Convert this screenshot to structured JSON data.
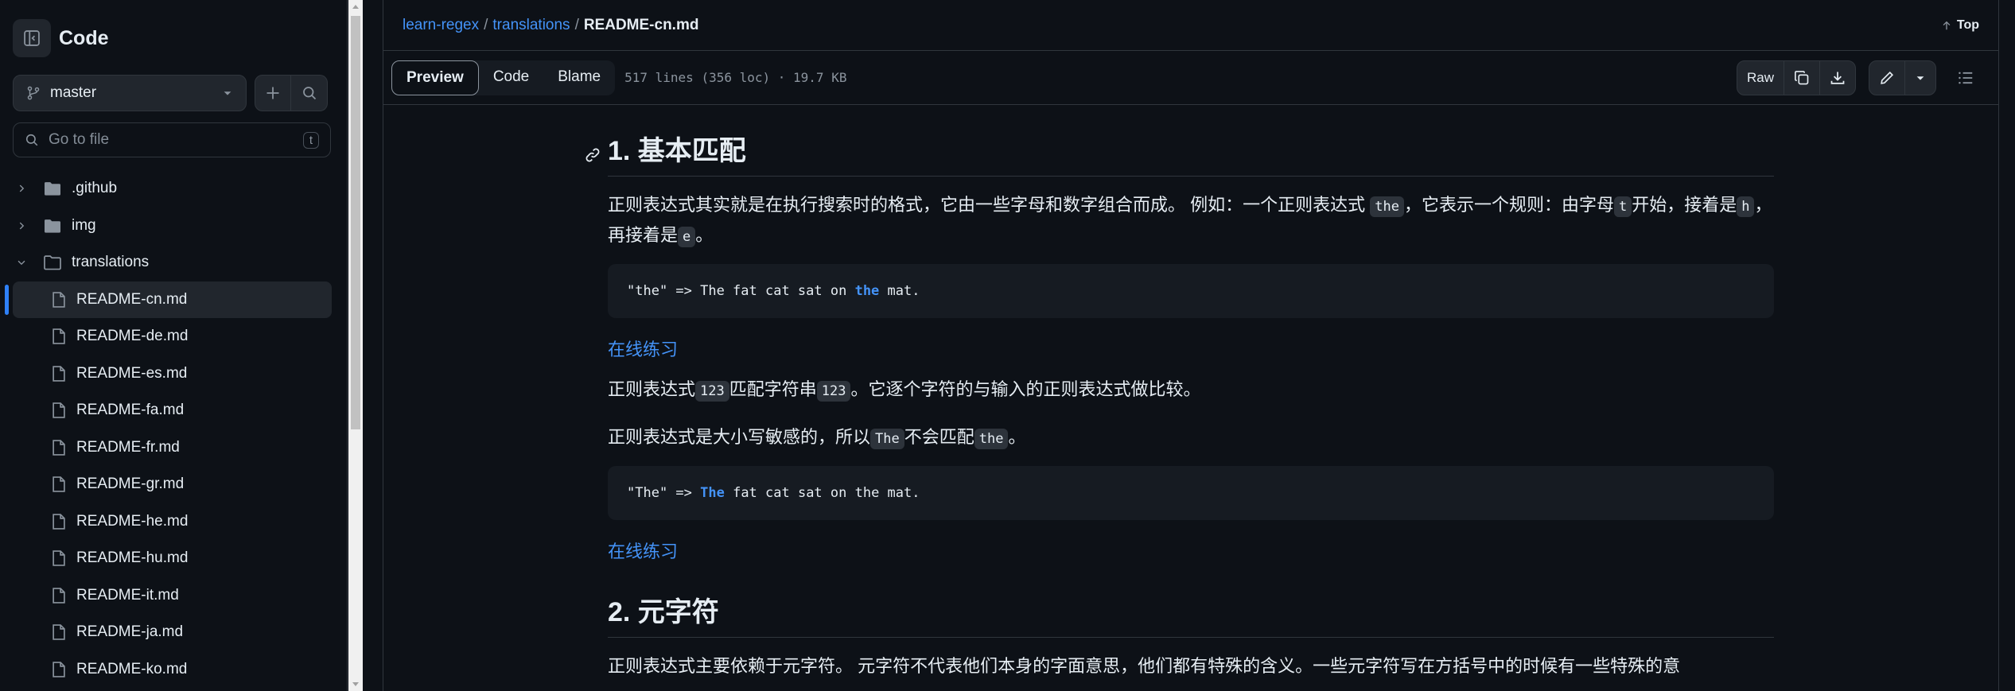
{
  "sidebar": {
    "title": "Code",
    "branch": "master",
    "search_placeholder": "Go to file",
    "search_kbd": "t",
    "tree": [
      {
        "label": ".github",
        "type": "folder",
        "expanded": false
      },
      {
        "label": "img",
        "type": "folder",
        "expanded": false
      },
      {
        "label": "translations",
        "type": "folder",
        "expanded": true
      },
      {
        "label": "README-cn.md",
        "type": "file",
        "selected": true
      },
      {
        "label": "README-de.md",
        "type": "file"
      },
      {
        "label": "README-es.md",
        "type": "file"
      },
      {
        "label": "README-fa.md",
        "type": "file"
      },
      {
        "label": "README-fr.md",
        "type": "file"
      },
      {
        "label": "README-gr.md",
        "type": "file"
      },
      {
        "label": "README-he.md",
        "type": "file"
      },
      {
        "label": "README-hu.md",
        "type": "file"
      },
      {
        "label": "README-it.md",
        "type": "file"
      },
      {
        "label": "README-ja.md",
        "type": "file"
      },
      {
        "label": "README-ko.md",
        "type": "file"
      }
    ]
  },
  "breadcrumb": {
    "repo": "learn-regex",
    "sep1": "/",
    "folder": "translations",
    "sep2": "/",
    "file": "README-cn.md"
  },
  "top_link": "Top",
  "toolbar": {
    "tabs": [
      "Preview",
      "Code",
      "Blame"
    ],
    "active_tab": "Preview",
    "meta": "517 lines (356 loc) · 19.7 KB",
    "raw": "Raw"
  },
  "article": {
    "h1": "1. 基本匹配",
    "p1_a": "正则表达式其实就是在执行搜索时的格式，它由一些字母和数字组合而成。 例如：一个正则表达式 ",
    "p1_code1": "the",
    "p1_b": "，它表示一个规则：由字母",
    "p1_code2": "t",
    "p1_c": "开始，接着是",
    "p1_code3": "h",
    "p1_d": "，再接着是",
    "p1_code4": "e",
    "p1_e": "。",
    "pre1_a": "\"the\" => The fat cat sat on ",
    "pre1_hl": "the",
    "pre1_b": " mat.",
    "link1": "在线练习",
    "p2_a": "正则表达式",
    "p2_code1": "123",
    "p2_b": "匹配字符串",
    "p2_code2": "123",
    "p2_c": "。它逐个字符的与输入的正则表达式做比较。",
    "p3_a": "正则表达式是大小写敏感的，所以",
    "p3_code1": "The",
    "p3_b": "不会匹配",
    "p3_code2": "the",
    "p3_c": "。",
    "pre2_a": "\"The\" => ",
    "pre2_hl": "The",
    "pre2_b": " fat cat sat on the mat.",
    "link2": "在线练习",
    "h2": "2. 元字符",
    "p4": "正则表达式主要依赖于元字符。 元字符不代表他们本身的字面意思，他们都有特殊的含义。一些元字符写在方括号中的时候有一些特殊的意"
  },
  "colors": {
    "bg": "#0d1117",
    "accent": "#2f81f7",
    "link": "#4493f8",
    "border": "#30363d"
  }
}
